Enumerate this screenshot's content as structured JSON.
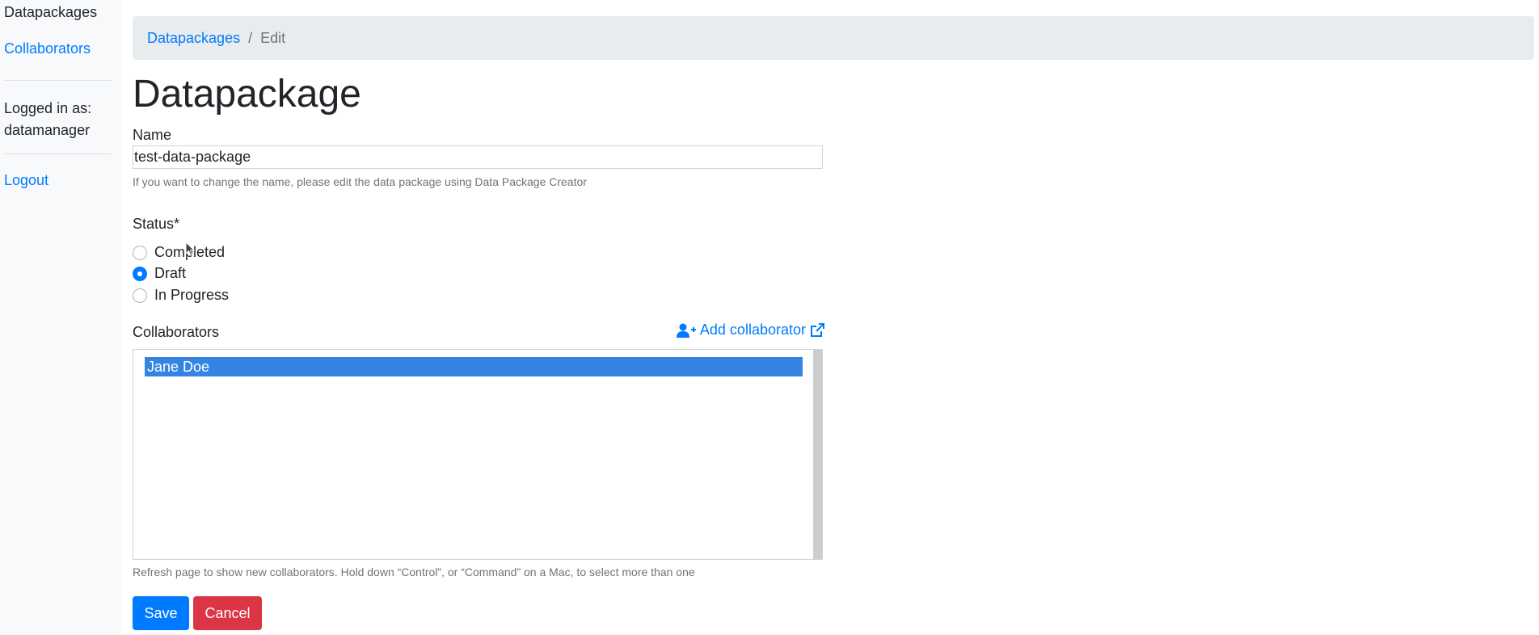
{
  "sidebar": {
    "current": "Datapackages",
    "collaborators_link": "Collaborators",
    "logged_in_label": "Logged in as:",
    "username": "datamanager",
    "logout": "Logout"
  },
  "breadcrumb": {
    "root": "Datapackages",
    "separator": "/",
    "current": "Edit"
  },
  "page": {
    "title": "Datapackage"
  },
  "form": {
    "name_label": "Name",
    "name_value": "test-data-package",
    "name_help": "If you want to change the name, please edit the data package using Data Package Creator",
    "status_label": "Status*",
    "status_options": [
      "Completed",
      "Draft",
      "In Progress"
    ],
    "status_selected": "Draft",
    "collaborators_label": "Collaborators",
    "add_collaborator": "Add collaborator",
    "collaborators_options": [
      "Jane Doe"
    ],
    "collaborators_help": "Refresh page to show new collaborators. Hold down “Control”, or “Command” on a Mac, to select more than one",
    "save": "Save",
    "cancel": "Cancel"
  },
  "colors": {
    "link": "#007bff",
    "primary": "#007bff",
    "danger": "#dc3545",
    "selection": "#3584e4"
  },
  "icons": {
    "add_collaborator": "user-plus-icon",
    "external_link": "external-link-icon"
  }
}
